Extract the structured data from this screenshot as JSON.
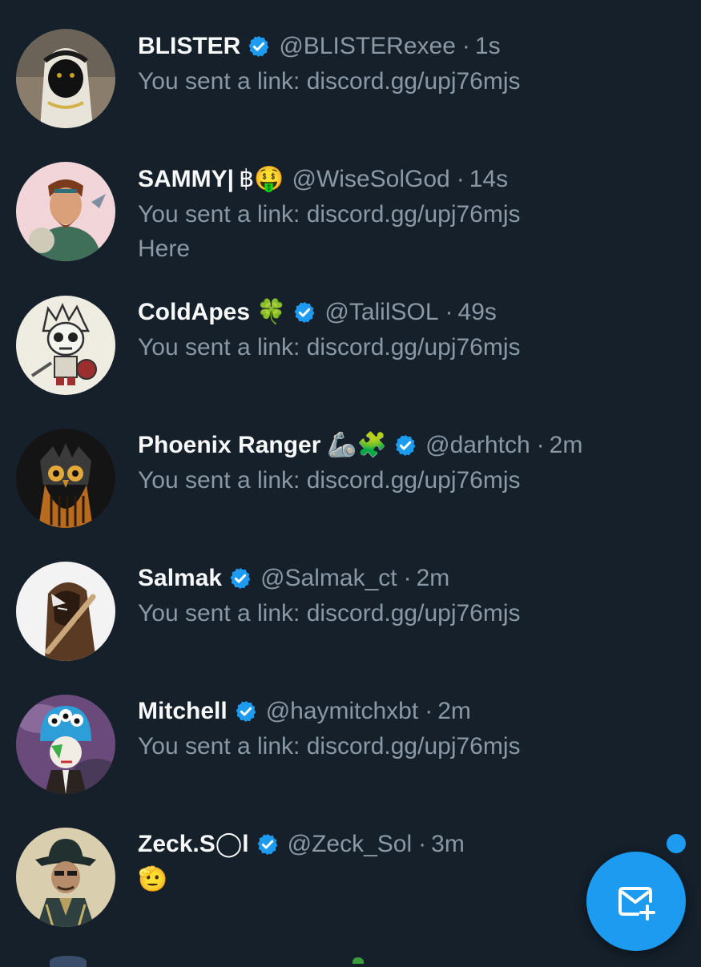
{
  "colors": {
    "background": "#15202b",
    "primary_text": "#f7f9f9",
    "secondary_text": "#8b98a5",
    "accent": "#1d9bf0"
  },
  "conversations": [
    {
      "display_name": "BLISTER",
      "emoji": "",
      "verified": true,
      "handle": "@BLISTERexee",
      "separator": "·",
      "time": "1s",
      "preview": [
        "You sent a link: discord.gg/upj76mjs"
      ],
      "avatar": "cat-in-headscarf-avatar"
    },
    {
      "display_name": "SAMMY|",
      "emoji": "฿🤑",
      "verified": false,
      "handle": "@WiseSolGod",
      "separator": "·",
      "time": "14s",
      "preview": [
        "You sent a link: discord.gg/upj76mjs",
        "Here"
      ],
      "avatar": "bearded-warrior-avatar"
    },
    {
      "display_name": "ColdApes",
      "emoji": "🍀",
      "verified": true,
      "handle": "@TalilSOL",
      "separator": "·",
      "time": "49s",
      "preview": [
        "You sent a link: discord.gg/upj76mjs"
      ],
      "avatar": "skeleton-knight-avatar"
    },
    {
      "display_name": "Phoenix Ranger",
      "emoji": "🦾🧩",
      "verified": true,
      "handle": "@darhtch",
      "separator": "·",
      "time": "2m",
      "preview": [
        "You sent a link: discord.gg/upj76mjs"
      ],
      "avatar": "owl-avatar"
    },
    {
      "display_name": "Salmak",
      "emoji": "",
      "verified": true,
      "handle": "@Salmak_ct",
      "separator": "·",
      "time": "2m",
      "preview": [
        "You sent a link: discord.gg/upj76mjs"
      ],
      "avatar": "hooded-figure-avatar"
    },
    {
      "display_name": "Mitchell",
      "emoji": "",
      "verified": true,
      "handle": "@haymitchxbt",
      "separator": "·",
      "time": "2m",
      "preview": [
        "You sent a link: discord.gg/upj76mjs"
      ],
      "avatar": "monster-hat-avatar"
    },
    {
      "display_name": "Zeck.S◯l",
      "emoji": "",
      "verified": true,
      "handle": "@Zeck_Sol",
      "separator": "·",
      "time": "3m",
      "preview": [
        "🫡"
      ],
      "avatar": "detective-hat-avatar"
    }
  ],
  "fab": {
    "icon": "new-message-icon"
  }
}
